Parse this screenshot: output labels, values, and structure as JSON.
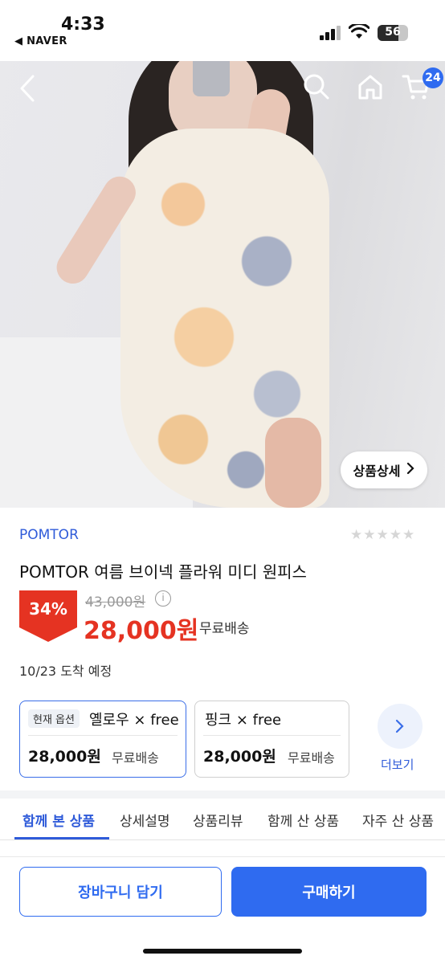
{
  "status_bar": {
    "time": "4:33",
    "back_app": "◀ NAVER",
    "battery": "56"
  },
  "nav": {
    "cart_count": "24",
    "back_icon": "chevron-left-icon",
    "search_icon": "search-icon",
    "home_icon": "home-icon",
    "cart_icon": "cart-icon"
  },
  "hero": {
    "detail_button": "상품상세"
  },
  "product": {
    "brand": "POMTOR",
    "rating_stars": "★★★★★",
    "title": "POMTOR 여름 브이넥 플라워 미디 원피스",
    "discount": "34%",
    "original_price": "43,000원",
    "sale_price": "28,000원",
    "shipping": "무료배송",
    "arrival": "10/23 도착 예정"
  },
  "options": [
    {
      "tag": "현재 옵션",
      "name": "옐로우 × free",
      "price": "28,000원",
      "shipping": "무료배송"
    },
    {
      "name": "핑크 × free",
      "price": "28,000원",
      "shipping": "무료배송"
    }
  ],
  "more": {
    "label": "더보기"
  },
  "tabs": [
    {
      "label": "함께 본 상품"
    },
    {
      "label": "상세설명"
    },
    {
      "label": "상품리뷰"
    },
    {
      "label": "함께 산 상품"
    },
    {
      "label": "자주 산 상품"
    }
  ],
  "actions": {
    "cart": "장바구니 담기",
    "buy": "구매하기"
  },
  "colors": {
    "accent": "#2f6bf0",
    "brand": "#2f5bd9",
    "sale": "#e53322"
  }
}
